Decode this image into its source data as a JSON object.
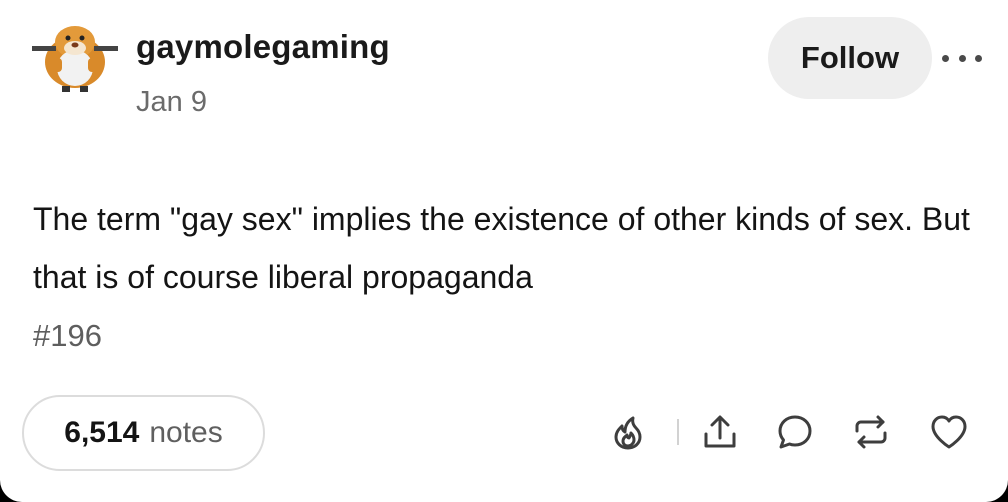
{
  "post": {
    "username": "gaymolegaming",
    "date": "Jan 9",
    "body": "The term \"gay sex\" implies the existence of other kinds of sex. But that is of course liberal propaganda",
    "tag": "#196"
  },
  "header": {
    "follow_label": "Follow",
    "more_icon": "more-options-icon"
  },
  "footer": {
    "notes_count": "6,514",
    "notes_label": "notes",
    "actions": [
      "flame-icon",
      "share-icon",
      "reply-icon",
      "reblog-icon",
      "heart-icon"
    ]
  },
  "colors": {
    "background": "#ffffff",
    "text": "#141414",
    "muted": "#6b6b6b",
    "follow_bg": "#eeeeee",
    "icon": "#3e3e3e"
  }
}
